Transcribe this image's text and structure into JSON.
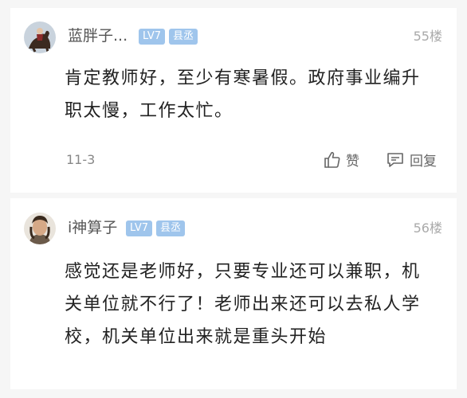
{
  "comments": [
    {
      "username": "蓝胖子...",
      "level": "LV7",
      "title": "县丞",
      "floor": "55楼",
      "text": "肯定教师好，至少有寒暑假。政府事业编升职太慢，工作太忙。",
      "date": "11-3",
      "like_label": "赞",
      "reply_label": "回复",
      "avatar_icon": "horse-rider-avatar"
    },
    {
      "username": "i神算子",
      "level": "LV7",
      "title": "县丞",
      "floor": "56楼",
      "text": "感觉还是老师好，只要专业还可以兼职，机关单位就不行了！老师出来还可以去私人学校，机关单位出来就是重头开始",
      "avatar_icon": "person-avatar"
    }
  ],
  "colors": {
    "badge_bg": "#9fc5ec",
    "page_bg": "#f6f6f6",
    "text_main": "#222222"
  }
}
